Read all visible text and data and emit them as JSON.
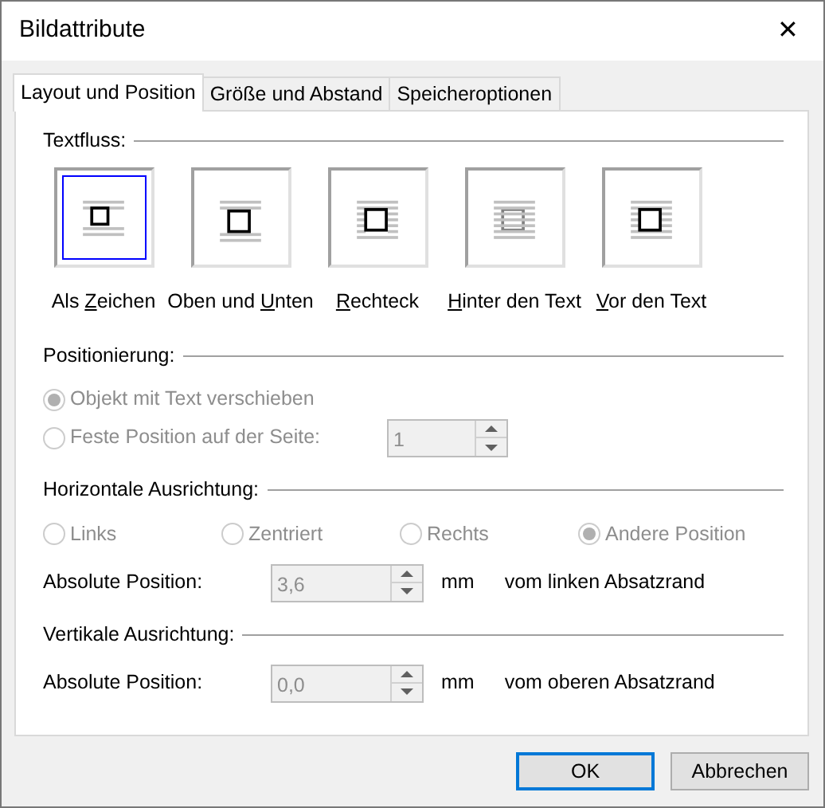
{
  "window": {
    "title": "Bildattribute",
    "close": "✕"
  },
  "tabs": [
    {
      "label": "Layout und Position",
      "selected": true
    },
    {
      "label": "Größe und Abstand",
      "selected": false
    },
    {
      "label": "Speicheroptionen",
      "selected": false
    }
  ],
  "textflow": {
    "heading": "Textfluss:",
    "options": [
      {
        "kind": "inline",
        "before": "Als ",
        "mnemonic": "Z",
        "after": "eichen",
        "selected": true
      },
      {
        "kind": "topbottom",
        "before": "Oben und ",
        "mnemonic": "U",
        "after": "nten",
        "selected": false
      },
      {
        "kind": "square",
        "mnemonic": "R",
        "after": "echteck",
        "selected": false
      },
      {
        "kind": "behind",
        "mnemonic": "H",
        "after": "inter den Text",
        "selected": false
      },
      {
        "kind": "front",
        "mnemonic": "V",
        "after": "or den Text",
        "selected": false
      }
    ]
  },
  "positioning": {
    "heading": "Positionierung:",
    "options": [
      {
        "label": "Objekt mit Text verschieben",
        "selected": true,
        "disabled": true
      },
      {
        "label": "Feste Position auf der Seite:",
        "selected": false,
        "disabled": true,
        "spinner": {
          "value": "1",
          "disabled": true
        }
      }
    ]
  },
  "horizontal": {
    "heading": "Horizontale Ausrichtung:",
    "options": [
      {
        "label": "Links",
        "selected": false,
        "disabled": true
      },
      {
        "label": "Zentriert",
        "selected": false,
        "disabled": true
      },
      {
        "label": "Rechts",
        "selected": false,
        "disabled": true
      },
      {
        "label": "Andere Position",
        "selected": true,
        "disabled": true
      }
    ],
    "absolute": {
      "label": "Absolute Position:",
      "value": "3,6",
      "disabled": true,
      "unit": "mm",
      "reference": "vom linken Absatzrand"
    }
  },
  "vertical": {
    "heading": "Vertikale Ausrichtung:",
    "absolute": {
      "label": "Absolute Position:",
      "value": "0,0",
      "disabled": true,
      "unit": "mm",
      "reference": "vom oberen Absatzrand"
    }
  },
  "buttons": [
    {
      "label": "OK",
      "default": true
    },
    {
      "label": "Abbrechen",
      "default": false
    }
  ]
}
